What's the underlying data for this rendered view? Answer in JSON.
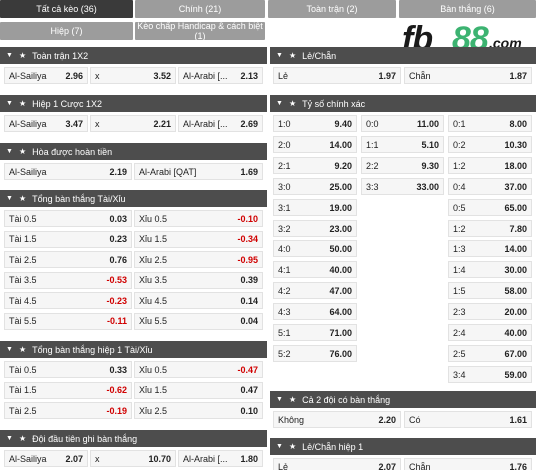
{
  "tabs": [
    {
      "label": "Tất cả kèo (36)",
      "active": true
    },
    {
      "label": "Chính (21)",
      "active": false
    },
    {
      "label": "Toàn trận (2)",
      "active": false
    },
    {
      "label": "Bàn thắng (6)",
      "active": false
    },
    {
      "label": "Hiệp (7)",
      "active": false
    },
    {
      "label": "Kèo chấp Handicap & cách biệt (1)",
      "active": false
    }
  ],
  "logo": {
    "fb": "fb",
    "num": "88",
    "com": ".com"
  },
  "left_sections": [
    {
      "title": "Toàn trận 1X2",
      "rows": [
        [
          {
            "l": "Al-Sailiya",
            "v": "2.96"
          },
          {
            "l": "x",
            "v": "3.52"
          },
          {
            "l": "Al-Arabi [...",
            "v": "2.13"
          }
        ]
      ]
    },
    {
      "title": "Hiệp 1 Cược 1X2",
      "rows": [
        [
          {
            "l": "Al-Sailiya",
            "v": "3.47"
          },
          {
            "l": "x",
            "v": "2.21"
          },
          {
            "l": "Al-Arabi [...",
            "v": "2.69"
          }
        ]
      ]
    },
    {
      "title": "Hòa được hoàn tiền",
      "rows": [
        [
          {
            "l": "Al-Sailiya",
            "v": "2.19"
          },
          {
            "l": "Al-Arabi [QAT]",
            "v": "1.69"
          }
        ]
      ]
    },
    {
      "title": "Tổng bàn thắng Tài/Xỉu",
      "rows": [
        [
          {
            "l": "Tài 0.5",
            "v": "0.03"
          },
          {
            "l": "Xỉu 0.5",
            "v": "-0.10"
          }
        ],
        [
          {
            "l": "Tài 1.5",
            "v": "0.23"
          },
          {
            "l": "Xỉu 1.5",
            "v": "-0.34"
          }
        ],
        [
          {
            "l": "Tài 2.5",
            "v": "0.76"
          },
          {
            "l": "Xỉu 2.5",
            "v": "-0.95"
          }
        ],
        [
          {
            "l": "Tài 3.5",
            "v": "-0.53"
          },
          {
            "l": "Xỉu 3.5",
            "v": "0.39"
          }
        ],
        [
          {
            "l": "Tài 4.5",
            "v": "-0.23"
          },
          {
            "l": "Xỉu 4.5",
            "v": "0.14"
          }
        ],
        [
          {
            "l": "Tài 5.5",
            "v": "-0.11"
          },
          {
            "l": "Xỉu 5.5",
            "v": "0.04"
          }
        ]
      ]
    },
    {
      "title": "Tổng bàn thắng hiệp 1 Tài/Xỉu",
      "rows": [
        [
          {
            "l": "Tài 0.5",
            "v": "0.33"
          },
          {
            "l": "Xỉu 0.5",
            "v": "-0.47"
          }
        ],
        [
          {
            "l": "Tài 1.5",
            "v": "-0.62"
          },
          {
            "l": "Xỉu 1.5",
            "v": "0.47"
          }
        ],
        [
          {
            "l": "Tài 2.5",
            "v": "-0.19"
          },
          {
            "l": "Xỉu 2.5",
            "v": "0.10"
          }
        ]
      ]
    },
    {
      "title": "Đội đầu tiên ghi bàn thắng",
      "rows": [
        [
          {
            "l": "Al-Sailiya",
            "v": "2.07"
          },
          {
            "l": "x",
            "v": "10.70"
          },
          {
            "l": "Al-Arabi [...",
            "v": "1.80"
          }
        ]
      ]
    }
  ],
  "right_sections": [
    {
      "title": "Lẻ/Chẵn",
      "rows": [
        [
          {
            "l": "Lẻ",
            "v": "1.97"
          },
          {
            "l": "Chẵn",
            "v": "1.87"
          }
        ]
      ]
    },
    {
      "title": "Tỷ số chính xác",
      "rows": [
        [
          {
            "l": "1:0",
            "v": "9.40"
          },
          {
            "l": "0:0",
            "v": "11.00"
          },
          {
            "l": "0:1",
            "v": "8.00"
          }
        ],
        [
          {
            "l": "2:0",
            "v": "14.00"
          },
          {
            "l": "1:1",
            "v": "5.10"
          },
          {
            "l": "0:2",
            "v": "10.30"
          }
        ],
        [
          {
            "l": "2:1",
            "v": "9.20"
          },
          {
            "l": "2:2",
            "v": "9.30"
          },
          {
            "l": "1:2",
            "v": "18.00"
          }
        ],
        [
          {
            "l": "3:0",
            "v": "25.00"
          },
          {
            "l": "3:3",
            "v": "33.00"
          },
          {
            "l": "0:4",
            "v": "37.00"
          }
        ],
        [
          {
            "l": "3:1",
            "v": "19.00"
          },
          null,
          {
            "l": "0:5",
            "v": "65.00"
          }
        ],
        [
          {
            "l": "3:2",
            "v": "23.00"
          },
          null,
          {
            "l": "1:2",
            "v": "7.80"
          }
        ],
        [
          {
            "l": "4:0",
            "v": "50.00"
          },
          null,
          {
            "l": "1:3",
            "v": "14.00"
          }
        ],
        [
          {
            "l": "4:1",
            "v": "40.00"
          },
          null,
          {
            "l": "1:4",
            "v": "30.00"
          }
        ],
        [
          {
            "l": "4:2",
            "v": "47.00"
          },
          null,
          {
            "l": "1:5",
            "v": "58.00"
          }
        ],
        [
          {
            "l": "4:3",
            "v": "64.00"
          },
          null,
          {
            "l": "2:3",
            "v": "20.00"
          }
        ],
        [
          {
            "l": "5:1",
            "v": "71.00"
          },
          null,
          {
            "l": "2:4",
            "v": "40.00"
          }
        ],
        [
          {
            "l": "5:2",
            "v": "76.00"
          },
          null,
          {
            "l": "2:5",
            "v": "67.00"
          }
        ],
        [
          null,
          null,
          {
            "l": "3:4",
            "v": "59.00"
          }
        ]
      ]
    },
    {
      "title": "Cả 2 đội có bàn thắng",
      "rows": [
        [
          {
            "l": "Không",
            "v": "2.20"
          },
          {
            "l": "Có",
            "v": "1.61"
          }
        ]
      ]
    },
    {
      "title": "Lẻ/Chẵn hiệp 1",
      "rows": [
        [
          {
            "l": "Lẻ",
            "v": "2.07"
          },
          {
            "l": "Chẵn",
            "v": "1.76"
          }
        ]
      ]
    }
  ]
}
